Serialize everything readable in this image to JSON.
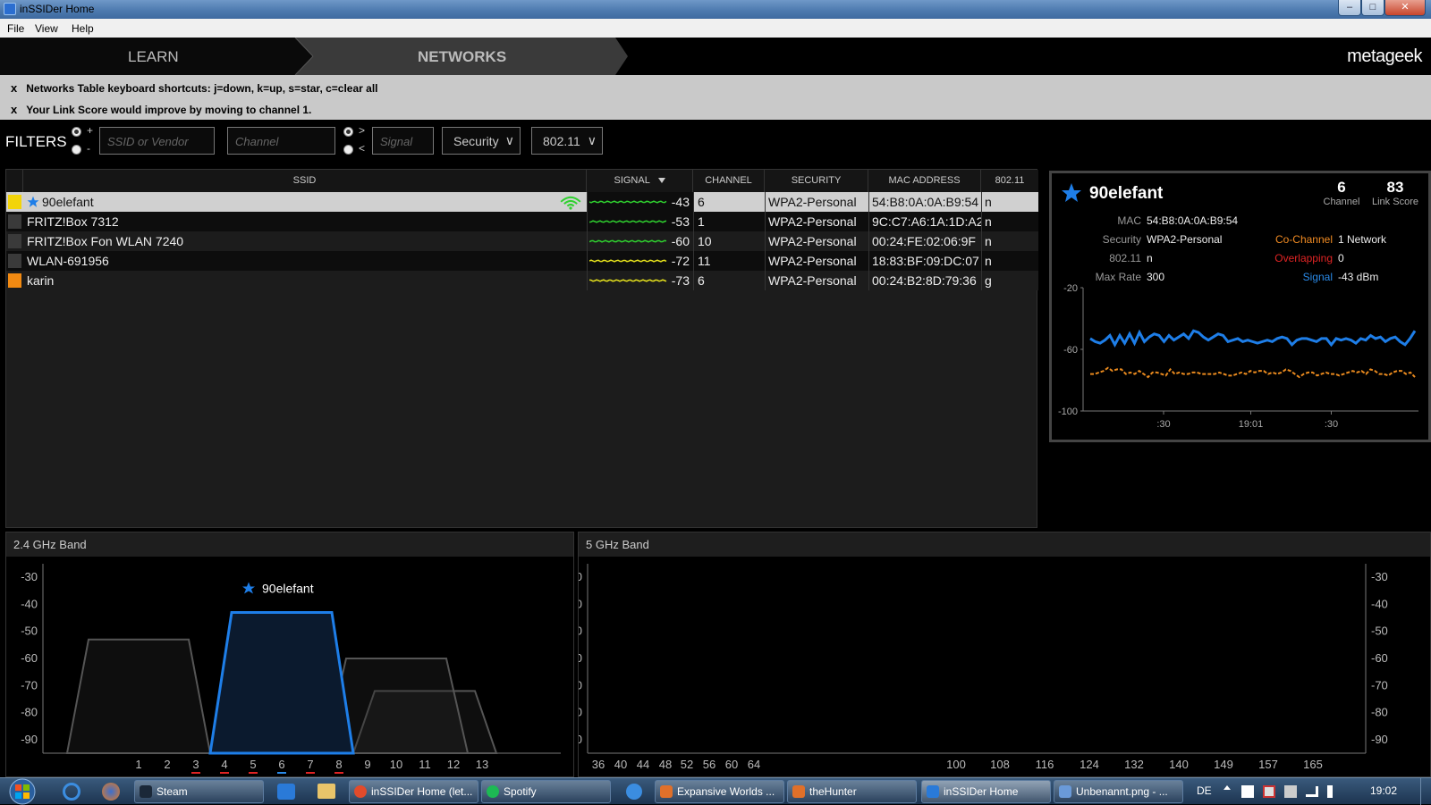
{
  "window": {
    "title": "inSSIDer Home",
    "minimize": "–",
    "maximize": "□",
    "close": "✕"
  },
  "menu": [
    "File",
    "View",
    "Help"
  ],
  "nav": {
    "tabs": [
      "LEARN",
      "NETWORKS"
    ],
    "active": "NETWORKS",
    "brand": "metageek"
  },
  "notices": [
    {
      "close": "x",
      "text": "Networks Table keyboard shortcuts: j=down, k=up, s=star, c=clear all"
    },
    {
      "close": "x",
      "text": "Your Link Score would improve by moving to channel 1."
    }
  ],
  "filters": {
    "label": "FILTERS",
    "plus": "+",
    "minus": "-",
    "gt": ">",
    "lt": "<",
    "ssid_placeholder": "SSID or Vendor",
    "channel_placeholder": "Channel",
    "signal_placeholder": "Signal",
    "security": "Security",
    "standard": "802.11",
    "chevron": "∨"
  },
  "table": {
    "columns": [
      "SSID",
      "SIGNAL",
      "CHANNEL",
      "SECURITY",
      "MAC ADDRESS",
      "802.11"
    ],
    "rows": [
      {
        "color": "#f2d40a",
        "starred": true,
        "ssid": "90elefant",
        "connected": true,
        "signal": "-43",
        "signal_color": "#2fd12f",
        "channel": "6",
        "security": "WPA2-Personal",
        "mac": "54:B8:0A:0A:B9:54",
        "std": "n"
      },
      {
        "color": "#3a3a3a",
        "starred": false,
        "ssid": "FRITZ!Box 7312",
        "connected": false,
        "signal": "-53",
        "signal_color": "#2fd12f",
        "channel": "1",
        "security": "WPA2-Personal",
        "mac": "9C:C7:A6:1A:1D:A2",
        "std": "n"
      },
      {
        "color": "#3a3a3a",
        "starred": false,
        "ssid": "FRITZ!Box Fon WLAN 7240",
        "connected": false,
        "signal": "-60",
        "signal_color": "#2fd12f",
        "channel": "10",
        "security": "WPA2-Personal",
        "mac": "00:24:FE:02:06:9F",
        "std": "n"
      },
      {
        "color": "#3a3a3a",
        "starred": false,
        "ssid": "WLAN-691956",
        "connected": false,
        "signal": "-72",
        "signal_color": "#e6e21c",
        "channel": "11",
        "security": "WPA2-Personal",
        "mac": "18:83:BF:09:DC:07",
        "std": "n"
      },
      {
        "color": "#f28a12",
        "starred": false,
        "ssid": "karin",
        "connected": false,
        "signal": "-73",
        "signal_color": "#e6e21c",
        "channel": "6",
        "security": "WPA2-Personal",
        "mac": "00:24:B2:8D:79:36",
        "std": "g"
      }
    ]
  },
  "detail": {
    "ssid": "90elefant",
    "channel": "6",
    "channel_label": "Channel",
    "link_score": "83",
    "link_score_label": "Link Score",
    "mac_label": "MAC",
    "mac": "54:B8:0A:0A:B9:54",
    "security_label": "Security",
    "security": "WPA2-Personal",
    "std_label": "802.11",
    "std": "n",
    "maxrate_label": "Max Rate",
    "maxrate": "300",
    "cochannel_label": "Co-Channel",
    "cochannel": "1 Network",
    "overlapping_label": "Overlapping",
    "overlapping": "0",
    "signal_label": "Signal",
    "signal": "-43 dBm",
    "colors": {
      "cochannel": "#f08a22",
      "overlapping": "#e02424",
      "signal": "#2a8ae8"
    }
  },
  "chart_data": [
    {
      "type": "line",
      "title": "",
      "ylim": [
        -100,
        -20
      ],
      "yticks": [
        -20,
        -60,
        -100
      ],
      "xticks": [
        ":30",
        "19:01",
        ":30"
      ],
      "series": [
        {
          "color": "#1e7ee8",
          "values": [
            -53,
            -55,
            -56,
            -54,
            -51,
            -57,
            -51,
            -56,
            -50,
            -56,
            -49,
            -55,
            -52,
            -50,
            -51,
            -55,
            -51,
            -54,
            -52,
            -50,
            -53,
            -48,
            -49,
            -52,
            -54,
            -52,
            -50,
            -51,
            -55,
            -54,
            -53,
            -55,
            -54,
            -55,
            -56,
            -55,
            -54,
            -55,
            -53,
            -52,
            -53,
            -57,
            -54,
            -53,
            -53,
            -54,
            -55,
            -53,
            -53,
            -57,
            -53,
            -54,
            -53,
            -54,
            -56,
            -53,
            -54,
            -51,
            -53,
            -52,
            -55,
            -53,
            -52,
            -55,
            -57,
            -53,
            -48
          ]
        },
        {
          "color": "#e8891e",
          "values": [
            -76,
            -76,
            -75,
            -74,
            -72,
            -74,
            -73,
            -73,
            -76,
            -75,
            -76,
            -74,
            -76,
            -78,
            -75,
            -75,
            -76,
            -77,
            -73,
            -76,
            -75,
            -76,
            -76,
            -75,
            -75,
            -76,
            -76,
            -76,
            -76,
            -75,
            -76,
            -77,
            -77,
            -76,
            -75,
            -76,
            -74,
            -75,
            -74,
            -74,
            -76,
            -75,
            -76,
            -75,
            -73,
            -74,
            -76,
            -78,
            -76,
            -75,
            -75,
            -77,
            -76,
            -75,
            -76,
            -76,
            -77,
            -76,
            -75,
            -74,
            -75,
            -74,
            -76,
            -73,
            -74,
            -76,
            -76,
            -77,
            -75,
            -74,
            -74,
            -76,
            -75,
            -78
          ]
        }
      ]
    },
    {
      "type": "area",
      "title": "2.4 GHz Band",
      "ylim": [
        -95,
        -25
      ],
      "yticks": [
        -30,
        -40,
        -50,
        -60,
        -70,
        -80,
        -90
      ],
      "xticks": [
        "1",
        "2",
        "3",
        "4",
        "5",
        "6",
        "7",
        "8",
        "9",
        "10",
        "11",
        "12",
        "13"
      ],
      "underline_channels": {
        "3": "#e02424",
        "4": "#e02424",
        "5": "#e02424",
        "6": "#2a8ae8",
        "7": "#e02424",
        "8": "#e02424"
      },
      "networks": [
        {
          "name": "FRITZ!Box 7312",
          "channel": 1,
          "signal": -53,
          "color": "#555555",
          "highlight": false
        },
        {
          "name": "WLAN-691956",
          "channel": 11,
          "signal": -72,
          "color": "#555555",
          "highlight": false
        },
        {
          "name": "FRITZ!Box Fon WLAN 7240",
          "channel": 10,
          "signal": -60,
          "color": "#555555",
          "highlight": false
        },
        {
          "name": "karin",
          "channel": 6,
          "signal": -73,
          "color": "#e8891e",
          "highlight": false
        },
        {
          "name": "90elefant",
          "channel": 6,
          "signal": -43,
          "color": "#1e7ee8",
          "highlight": true
        }
      ],
      "label": "90elefant"
    },
    {
      "type": "area",
      "title": "5 GHz Band",
      "ylim": [
        -95,
        -25
      ],
      "yticks": [
        -30,
        -40,
        -50,
        -60,
        -70,
        -80,
        -90
      ],
      "xticks": [
        "36",
        "40",
        "44",
        "48",
        "52",
        "56",
        "60",
        "64",
        "100",
        "108",
        "116",
        "124",
        "132",
        "140",
        "149",
        "157",
        "165"
      ],
      "networks": []
    }
  ],
  "taskbar": {
    "items": [
      {
        "label": "Steam",
        "color": "#1b2838"
      },
      {
        "label": "inSSIDer Home (let...",
        "color": "#e34b2b"
      },
      {
        "label": "Spotify",
        "color": "#1db954"
      },
      {
        "label": "Expansive Worlds ...",
        "color": "#e0702a"
      },
      {
        "label": "theHunter",
        "color": "#e0702a"
      },
      {
        "label": "inSSIDer Home",
        "color": "#2a7ad8"
      },
      {
        "label": "Unbenannt.png - ...",
        "color": "#6a9ad8"
      }
    ],
    "lang": "DE",
    "time": "19:02"
  }
}
